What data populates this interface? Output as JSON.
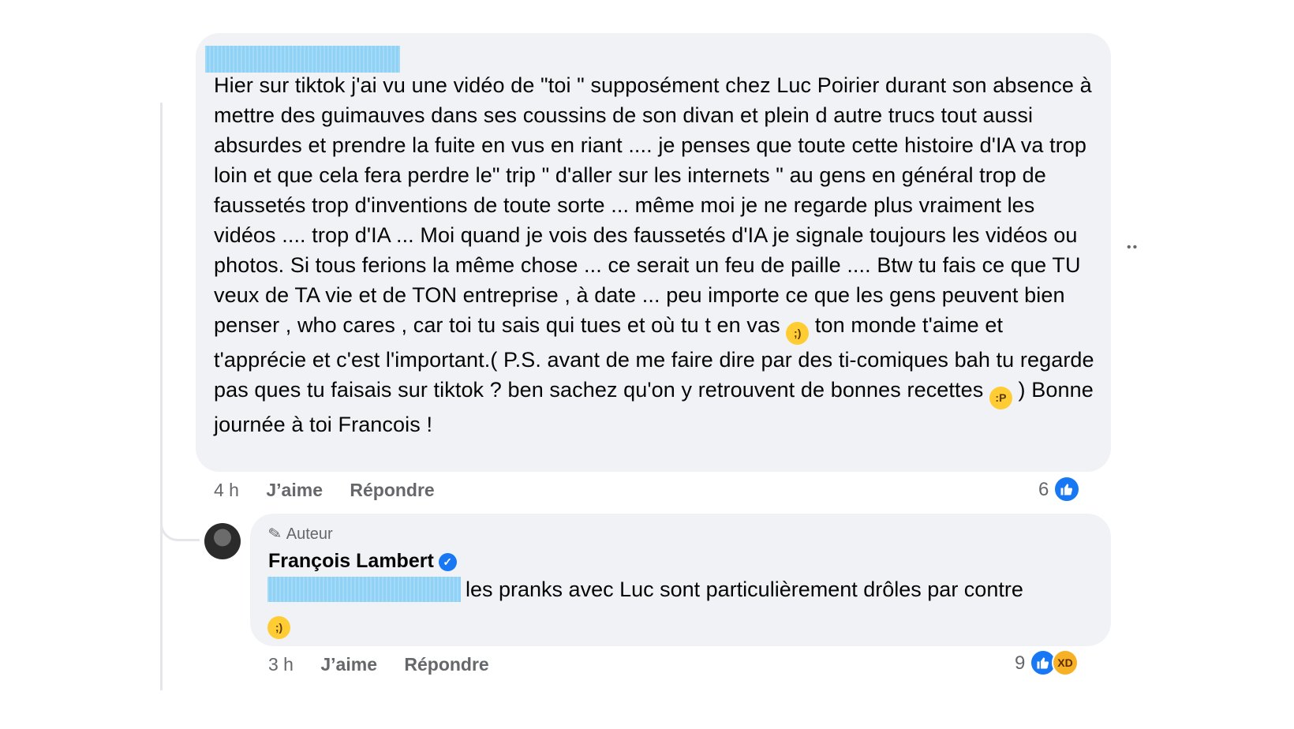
{
  "comment": {
    "text_parts": [
      "Hier sur tiktok j'ai vu une vidéo de \"toi \" supposément chez Luc Poirier durant son absence à mettre des guimauves dans ses coussins de son divan et plein d autre trucs tout aussi absurdes et prendre la fuite en vus en riant .... je penses que toute cette histoire d'IA va trop loin et que cela fera perdre le\" trip \" d'aller sur les internets \" au gens en général trop de faussetés trop d'inventions de toute sorte ... même moi je ne regarde plus vraiment les vidéos .... trop d'IA ... Moi quand je vois des faussetés d'IA je signale toujours les vidéos ou photos. Si tous ferions la même chose ... ce serait un feu de paille .... Btw tu fais ce que TU veux de TA vie et de TON entreprise , à date ... peu importe ce que les gens peuvent bien penser , who cares , car toi tu sais qui tues et où tu t en vas",
      "ton monde t'aime et t'apprécie et c'est l'important.( P.S. avant de me faire dire par des ti-comiques bah tu regarde pas ques tu faisais sur tiktok ? ben sachez qu'on y retrouvent de bonnes recettes",
      ") Bonne journée à toi Francois !"
    ],
    "time": "4 h",
    "like_label": "J’aime",
    "reply_label": "Répondre",
    "reaction_count": "6",
    "emoji_1": "wink-emoji",
    "emoji_2": "tongue-emoji"
  },
  "reply": {
    "author_tag": "Auteur",
    "author_name": "François Lambert",
    "text": "les pranks avec Luc sont particulièrement drôles par contre",
    "time": "3 h",
    "like_label": "J’aime",
    "reply_label": "Répondre",
    "reaction_count": "9",
    "emoji": "wink-emoji"
  },
  "colors": {
    "bubble": "#f0f2f5",
    "like_blue": "#1877f2",
    "meta_gray": "#65676b",
    "redaction": "#8fd2f6"
  }
}
